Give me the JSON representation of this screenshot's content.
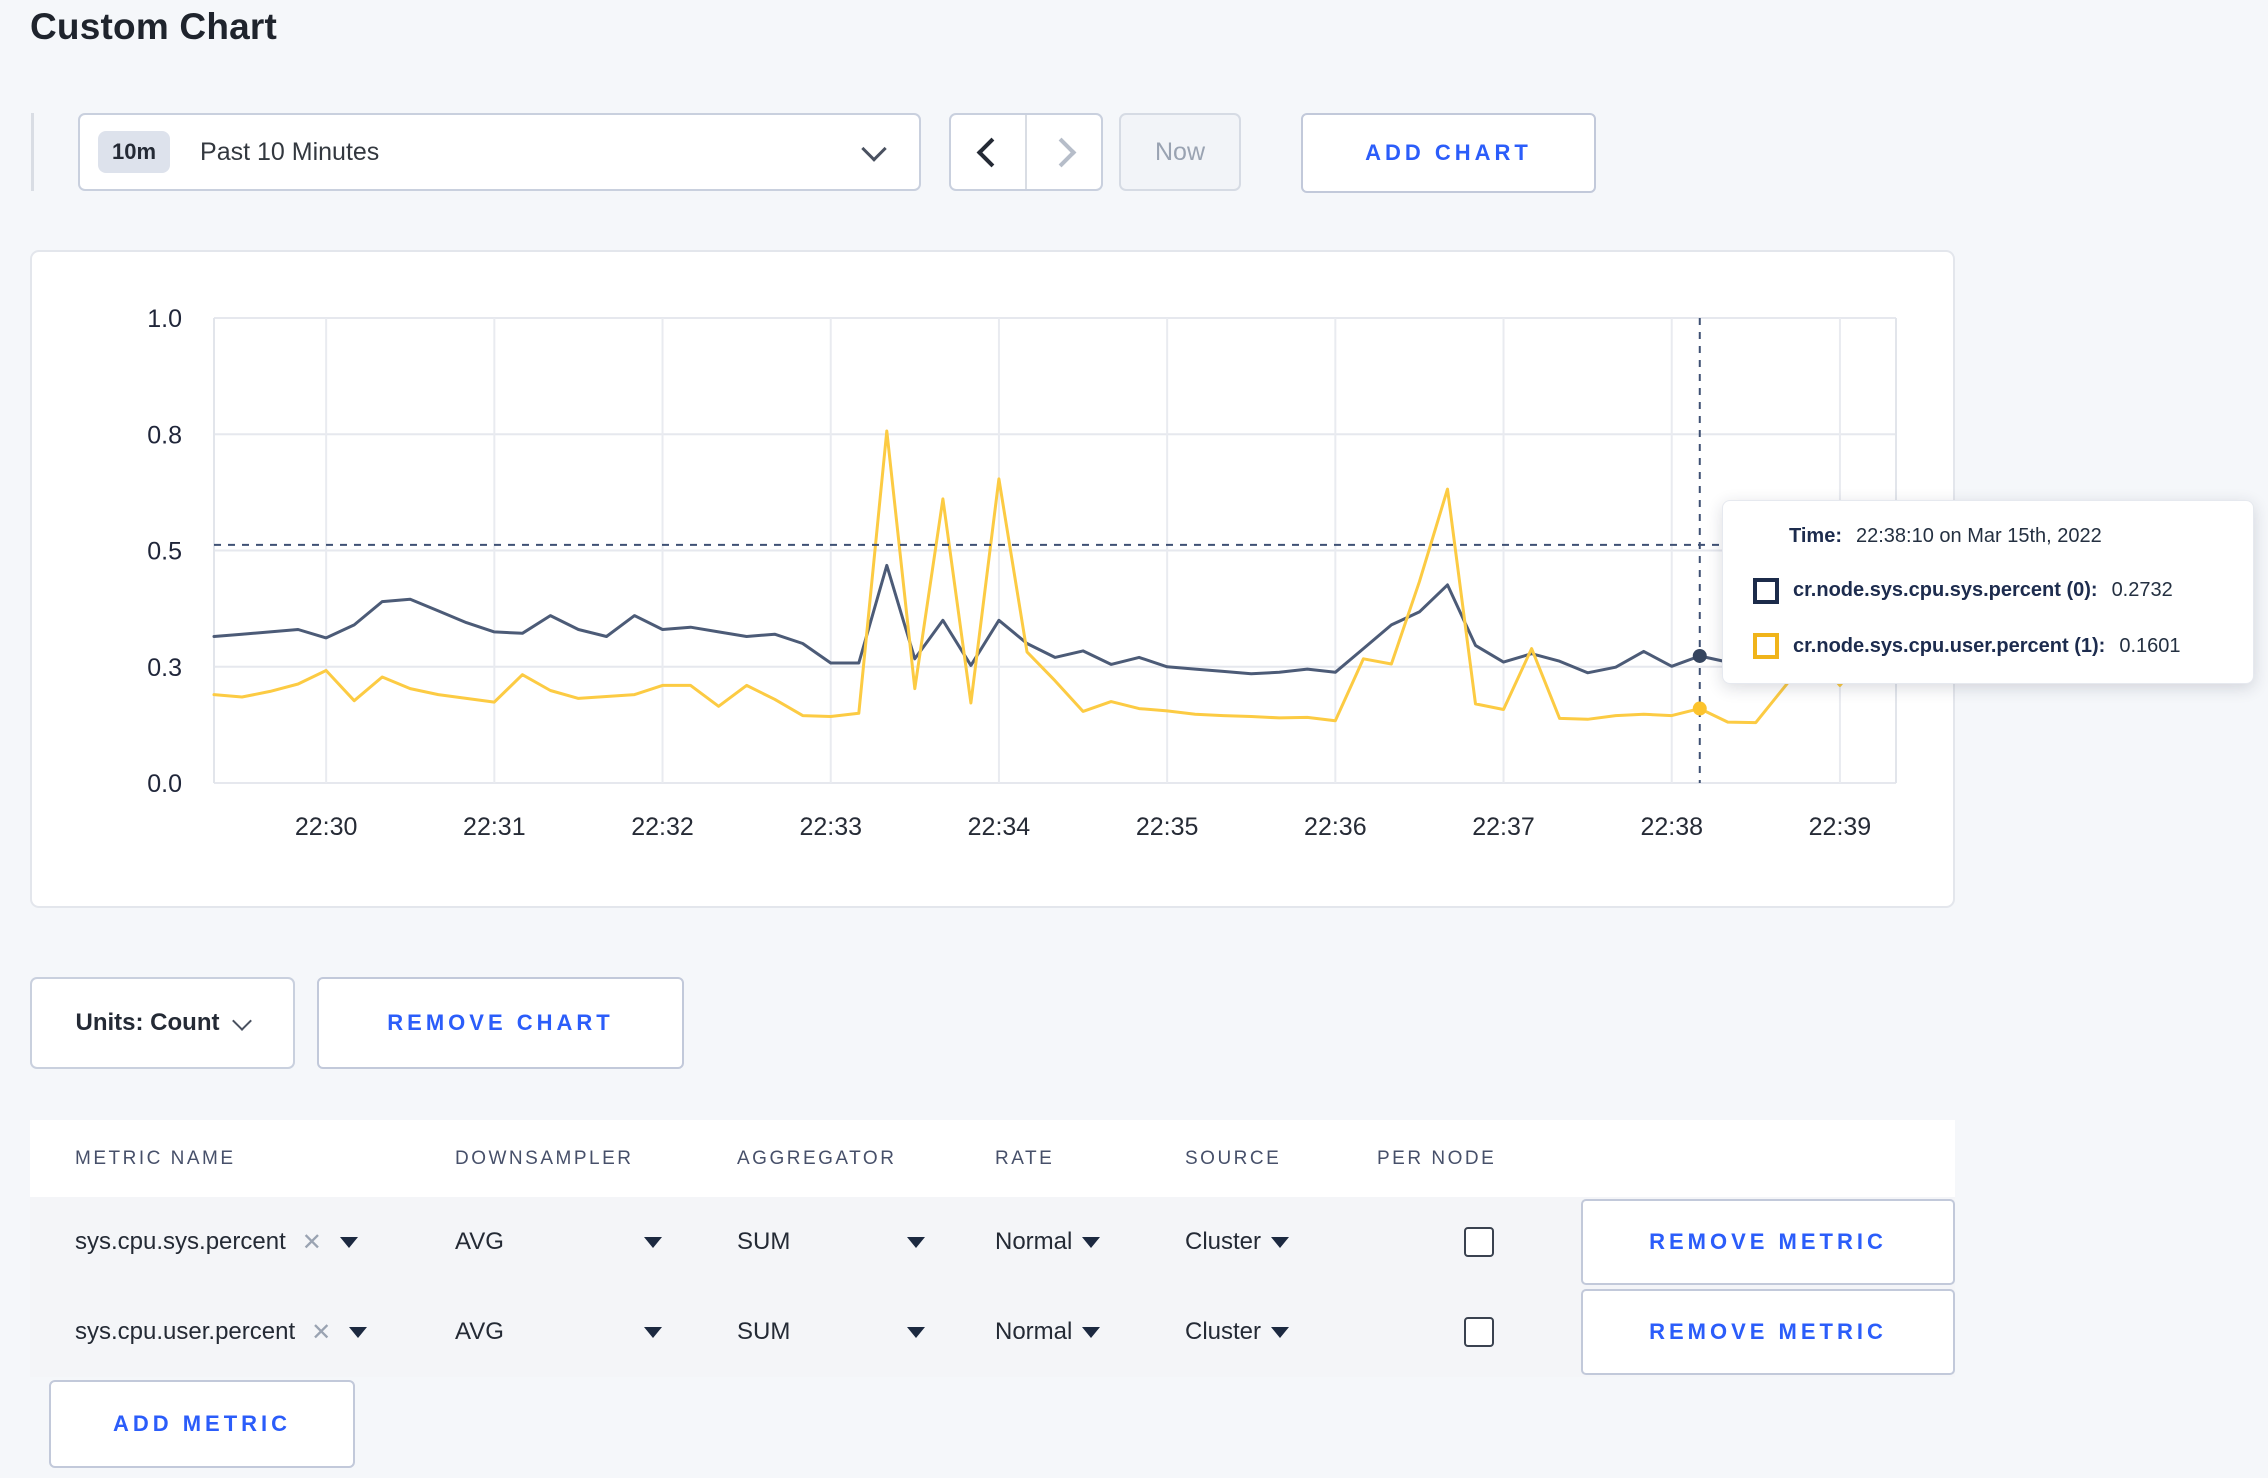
{
  "page": {
    "title": "Custom Chart"
  },
  "colors": {
    "accent_blue": "#2b5dfa",
    "page_bg": "#f5f7fa",
    "series_sys": "#4c5b77",
    "series_user": "#fccb43",
    "grid": "#e6e8ee",
    "crosshair": "#3f5174"
  },
  "toolbar": {
    "timescale": {
      "badge": "10m",
      "label": "Past 10 Minutes"
    },
    "now_label": "Now",
    "add_chart_label": "ADD CHART"
  },
  "chart_data": {
    "type": "line",
    "title": "",
    "xlabel": "",
    "ylabel": "",
    "ylim": [
      0,
      1
    ],
    "grid": true,
    "x_start": "22:29:20",
    "x_end": "22:39:20",
    "x_interval_seconds": 10,
    "x_span_seconds": 600,
    "x_ticks": [
      "22:30",
      "22:31",
      "22:32",
      "22:33",
      "22:34",
      "22:35",
      "22:36",
      "22:37",
      "22:38",
      "22:39"
    ],
    "x_first_tick_offset_seconds": 40,
    "x_tick_interval_seconds": 60,
    "y_ticks": [
      {
        "label": "1.0",
        "value": 1.0
      },
      {
        "label": "0.8",
        "value": 0.75
      },
      {
        "label": "0.5",
        "value": 0.5
      },
      {
        "label": "0.3",
        "value": 0.25
      },
      {
        "label": "0.0",
        "value": 0.0
      }
    ],
    "series": [
      {
        "name": "cr.node.sys.cpu.sys.percent",
        "color": "#4c5b77",
        "values": [
          0.315,
          0.32,
          0.325,
          0.33,
          0.312,
          0.34,
          0.39,
          0.395,
          0.37,
          0.345,
          0.325,
          0.322,
          0.36,
          0.33,
          0.315,
          0.36,
          0.33,
          0.335,
          0.325,
          0.315,
          0.32,
          0.3,
          0.258,
          0.258,
          0.468,
          0.267,
          0.35,
          0.253,
          0.35,
          0.3,
          0.27,
          0.284,
          0.255,
          0.27,
          0.25,
          0.245,
          0.24,
          0.235,
          0.238,
          0.245,
          0.238,
          0.289,
          0.34,
          0.368,
          0.426,
          0.296,
          0.26,
          0.278,
          0.262,
          0.237,
          0.249,
          0.283,
          0.251,
          0.2732,
          0.26,
          0.272,
          0.29,
          0.302,
          0.27,
          0.305,
          0.298
        ]
      },
      {
        "name": "cr.node.sys.cpu.user.percent",
        "color": "#fccb43",
        "values": [
          0.19,
          0.185,
          0.197,
          0.213,
          0.242,
          0.177,
          0.228,
          0.203,
          0.19,
          0.182,
          0.174,
          0.233,
          0.199,
          0.182,
          0.186,
          0.19,
          0.21,
          0.21,
          0.165,
          0.21,
          0.18,
          0.145,
          0.143,
          0.15,
          0.757,
          0.203,
          0.611,
          0.172,
          0.654,
          0.282,
          0.22,
          0.154,
          0.175,
          0.16,
          0.155,
          0.148,
          0.145,
          0.143,
          0.14,
          0.141,
          0.134,
          0.267,
          0.256,
          0.433,
          0.632,
          0.17,
          0.158,
          0.289,
          0.139,
          0.137,
          0.145,
          0.148,
          0.145,
          0.1601,
          0.131,
          0.13,
          0.205,
          0.28,
          0.21,
          0.285,
          0.245
        ]
      }
    ],
    "crosshair": {
      "time": "22:38:10",
      "index": 53,
      "y_value": 0.512
    }
  },
  "tooltip": {
    "time_label": "Time:",
    "time_value": "22:38:10 on Mar 15th, 2022",
    "rows": [
      {
        "label": "cr.node.sys.cpu.sys.percent (0):",
        "value": "0.2732",
        "swatch_color": "#1c2b4a"
      },
      {
        "label": "cr.node.sys.cpu.user.percent (1):",
        "value": "0.1601",
        "swatch_color": "#f0b41a"
      }
    ]
  },
  "chart_footer": {
    "units_label": "Units: Count",
    "remove_chart_label": "REMOVE CHART"
  },
  "metrics": {
    "columns": [
      "METRIC NAME",
      "DOWNSAMPLER",
      "AGGREGATOR",
      "RATE",
      "SOURCE",
      "PER NODE"
    ],
    "rows": [
      {
        "name": "sys.cpu.sys.percent",
        "downsampler": "AVG",
        "aggregator": "SUM",
        "rate": "Normal",
        "source": "Cluster",
        "per_node_checked": false,
        "remove_label": "REMOVE METRIC"
      },
      {
        "name": "sys.cpu.user.percent",
        "downsampler": "AVG",
        "aggregator": "SUM",
        "rate": "Normal",
        "source": "Cluster",
        "per_node_checked": false,
        "remove_label": "REMOVE METRIC"
      }
    ],
    "add_metric_label": "ADD METRIC"
  },
  "icons": {
    "clear": "✕"
  }
}
